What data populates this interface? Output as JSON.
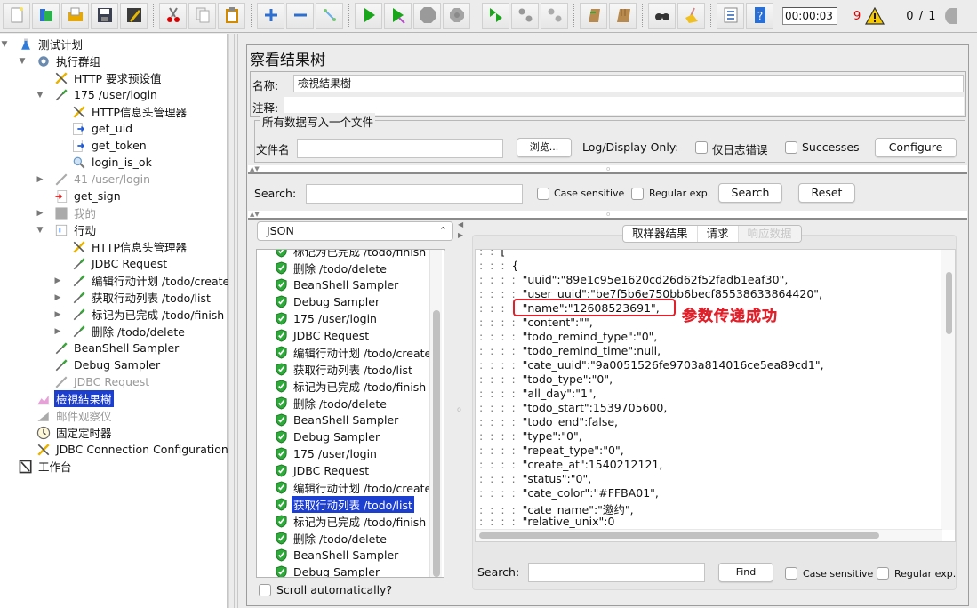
{
  "toolbar": {
    "buttons": [
      {
        "name": "new-icon"
      },
      {
        "name": "templates-icon"
      },
      {
        "name": "open-icon"
      },
      {
        "name": "save-icon"
      },
      {
        "name": "edit-icon"
      },
      {
        "name": "cut-icon"
      },
      {
        "name": "copy-icon"
      },
      {
        "name": "paste-icon"
      },
      {
        "name": "expand-icon"
      },
      {
        "name": "collapse-icon"
      },
      {
        "name": "toggle-icon"
      },
      {
        "name": "start-icon"
      },
      {
        "name": "start-no-pause-icon"
      },
      {
        "name": "stop-icon"
      },
      {
        "name": "shutdown-icon"
      },
      {
        "name": "remote-start-icon"
      },
      {
        "name": "remote-stop-icon"
      },
      {
        "name": "remote-shutdown-icon"
      },
      {
        "name": "clear-icon"
      },
      {
        "name": "clear-all-icon"
      },
      {
        "name": "search-icon"
      },
      {
        "name": "reset-search-icon"
      },
      {
        "name": "function-helper-icon"
      },
      {
        "name": "help-icon"
      }
    ],
    "timer": "00:00:03",
    "error_count": "9",
    "thread_count": "0 / 1"
  },
  "tree": [
    {
      "label": "测试计划",
      "icon": "test-plan-icon",
      "expand": "open",
      "level": 0,
      "state": "normal"
    },
    {
      "label": "执行群组",
      "icon": "thread-group-icon",
      "expand": "open",
      "level": 1,
      "state": "normal"
    },
    {
      "label": "HTTP 要求预设值",
      "icon": "config-element-icon",
      "expand": "",
      "level": 2,
      "state": "normal"
    },
    {
      "label": "175 /user/login",
      "icon": "sampler-icon",
      "expand": "open",
      "level": 2,
      "state": "normal"
    },
    {
      "label": "HTTP信息头管理器",
      "icon": "config-element-icon",
      "expand": "",
      "level": 3,
      "state": "normal"
    },
    {
      "label": "get_uid",
      "icon": "post-processor-icon",
      "expand": "",
      "level": 3,
      "state": "normal"
    },
    {
      "label": "get_token",
      "icon": "post-processor-icon",
      "expand": "",
      "level": 3,
      "state": "normal"
    },
    {
      "label": "login_is_ok",
      "icon": "assertion-icon",
      "expand": "",
      "level": 3,
      "state": "normal"
    },
    {
      "label": "41 /user/login",
      "icon": "sampler-disabled-icon",
      "expand": "closed",
      "level": 2,
      "state": "disabled"
    },
    {
      "label": "get_sign",
      "icon": "pre-processor-icon",
      "expand": "",
      "level": 2,
      "state": "normal"
    },
    {
      "label": "我的",
      "icon": "controller-disabled-icon",
      "expand": "closed",
      "level": 2,
      "state": "disabled"
    },
    {
      "label": "行动",
      "icon": "controller-icon",
      "expand": "open",
      "level": 2,
      "state": "normal"
    },
    {
      "label": "HTTP信息头管理器",
      "icon": "config-element-icon",
      "expand": "",
      "level": 3,
      "state": "normal"
    },
    {
      "label": "JDBC Request",
      "icon": "sampler-icon",
      "expand": "",
      "level": 3,
      "state": "normal"
    },
    {
      "label": "编辑行动计划 /todo/create",
      "icon": "sampler-icon",
      "expand": "closed",
      "level": 3,
      "state": "normal"
    },
    {
      "label": "获取行动列表 /todo/list",
      "icon": "sampler-icon",
      "expand": "closed",
      "level": 3,
      "state": "normal"
    },
    {
      "label": "标记为已完成 /todo/finish",
      "icon": "sampler-icon",
      "expand": "closed",
      "level": 3,
      "state": "normal"
    },
    {
      "label": "删除 /todo/delete",
      "icon": "sampler-icon",
      "expand": "closed",
      "level": 3,
      "state": "normal"
    },
    {
      "label": "BeanShell Sampler",
      "icon": "sampler-icon",
      "expand": "",
      "level": 2,
      "state": "normal"
    },
    {
      "label": "Debug Sampler",
      "icon": "sampler-icon",
      "expand": "",
      "level": 2,
      "state": "normal"
    },
    {
      "label": "JDBC Request",
      "icon": "sampler-disabled-icon",
      "expand": "",
      "level": 2,
      "state": "disabled"
    },
    {
      "label": "檢視結果樹",
      "icon": "listener-icon",
      "expand": "",
      "level": 1,
      "state": "selected"
    },
    {
      "label": "邮件观察仪",
      "icon": "listener-disabled-icon",
      "expand": "",
      "level": 1,
      "state": "disabled"
    },
    {
      "label": "固定定时器",
      "icon": "timer-icon",
      "expand": "",
      "level": 1,
      "state": "normal"
    },
    {
      "label": "JDBC Connection Configuration",
      "icon": "config-element-icon",
      "expand": "",
      "level": 1,
      "state": "normal"
    },
    {
      "label": "工作台",
      "icon": "workbench-icon",
      "expand": "",
      "level": 0,
      "state": "normal"
    }
  ],
  "panel": {
    "title": "察看结果树",
    "name_label": "名称:",
    "name_value": "檢視結果樹",
    "comment_label": "注释:",
    "comment_value": "",
    "file_group_title": "所有数据写入一个文件",
    "filename_label": "文件名",
    "filename_value": "",
    "browse_label": "浏览...",
    "log_display_label": "Log/Display Only:",
    "errors_only_label": "仅日志错误",
    "successes_label": "Successes",
    "configure_label": "Configure",
    "search_label": "Search:",
    "search_value": "",
    "case_sensitive_label": "Case sensitive",
    "regex_label": "Regular exp.",
    "search_button": "Search",
    "reset_button": "Reset"
  },
  "results": {
    "renderer": "JSON",
    "items": [
      {
        "label": "标记为已完成 /todo/finish",
        "status": "success",
        "selected": false
      },
      {
        "label": "删除 /todo/delete",
        "status": "success",
        "selected": false
      },
      {
        "label": "BeanShell Sampler",
        "status": "success",
        "selected": false
      },
      {
        "label": "Debug Sampler",
        "status": "success",
        "selected": false
      },
      {
        "label": "175 /user/login",
        "status": "success",
        "selected": false
      },
      {
        "label": "JDBC Request",
        "status": "success",
        "selected": false
      },
      {
        "label": "编辑行动计划 /todo/create",
        "status": "success",
        "selected": false
      },
      {
        "label": "获取行动列表 /todo/list",
        "status": "success",
        "selected": false
      },
      {
        "label": "标记为已完成 /todo/finish",
        "status": "success",
        "selected": false
      },
      {
        "label": "删除 /todo/delete",
        "status": "success",
        "selected": false
      },
      {
        "label": "BeanShell Sampler",
        "status": "success",
        "selected": false
      },
      {
        "label": "Debug Sampler",
        "status": "success",
        "selected": false
      },
      {
        "label": "175 /user/login",
        "status": "success",
        "selected": false
      },
      {
        "label": "JDBC Request",
        "status": "success",
        "selected": false
      },
      {
        "label": "编辑行动计划 /todo/create",
        "status": "success",
        "selected": false
      },
      {
        "label": "获取行动列表 /todo/list",
        "status": "success",
        "selected": true
      },
      {
        "label": "标记为已完成 /todo/finish",
        "status": "success",
        "selected": false
      },
      {
        "label": "删除 /todo/delete",
        "status": "success",
        "selected": false
      },
      {
        "label": "BeanShell Sampler",
        "status": "success",
        "selected": false
      },
      {
        "label": "Debug Sampler",
        "status": "success",
        "selected": false
      }
    ],
    "scroll_auto_label": "Scroll automatically?"
  },
  "detail": {
    "tabs": [
      {
        "label": "取样器结果",
        "enabled": true
      },
      {
        "label": "请求",
        "enabled": true
      },
      {
        "label": "响应数据",
        "enabled": false
      }
    ],
    "json_lines": [
      {
        "guides": ":  :  ",
        "text": "["
      },
      {
        "guides": ":  :  :  ",
        "text": "{"
      },
      {
        "guides": ":  :  :  :  ",
        "text": "\"uuid\":\"89e1c95e1620cd26d62f52fadb1eaf30\","
      },
      {
        "guides": ":  :  :  :  ",
        "text": "\"user_uuid\":\"be7f5b6e750bb6becf85538633864420\","
      },
      {
        "guides": ":  :  :  :  ",
        "text": "\"name\":\"12608523691\","
      },
      {
        "guides": ":  :  :  :  ",
        "text": "\"content\":\"\","
      },
      {
        "guides": ":  :  :  :  ",
        "text": "\"todo_remind_type\":\"0\","
      },
      {
        "guides": ":  :  :  :  ",
        "text": "\"todo_remind_time\":null,"
      },
      {
        "guides": ":  :  :  :  ",
        "text": "\"cate_uuid\":\"9a0051526fe9703a814016ce5ea89cd1\","
      },
      {
        "guides": ":  :  :  :  ",
        "text": "\"todo_type\":\"0\","
      },
      {
        "guides": ":  :  :  :  ",
        "text": "\"all_day\":\"1\","
      },
      {
        "guides": ":  :  :  :  ",
        "text": "\"todo_start\":1539705600,"
      },
      {
        "guides": ":  :  :  :  ",
        "text": "\"todo_end\":false,"
      },
      {
        "guides": ":  :  :  :  ",
        "text": "\"type\":\"0\","
      },
      {
        "guides": ":  :  :  :  ",
        "text": "\"repeat_type\":\"0\","
      },
      {
        "guides": ":  :  :  :  ",
        "text": "\"create_at\":1540212121,"
      },
      {
        "guides": ":  :  :  :  ",
        "text": "\"status\":\"0\","
      },
      {
        "guides": ":  :  :  :  ",
        "text": "\"cate_color\":\"#FFBA01\","
      },
      {
        "guides": ":  :  :  :  ",
        "text": "\"cate_name\":\"邀约\","
      },
      {
        "guides": ":  :  :  :  ",
        "text": "\"relative_unix\":0"
      },
      {
        "guides": ":  :  :  ",
        "text": "},"
      }
    ],
    "annotation": "参数传递成功",
    "find_label": "Search:",
    "find_value": "",
    "find_button": "Find",
    "case_sensitive_label": "Case sensitive",
    "regex_label": "Regular exp."
  },
  "colors": {
    "selection": "#1d3fcf",
    "annotation": "#e0202a",
    "error_count": "#e00000",
    "success_shield": "#2eaa3a"
  }
}
